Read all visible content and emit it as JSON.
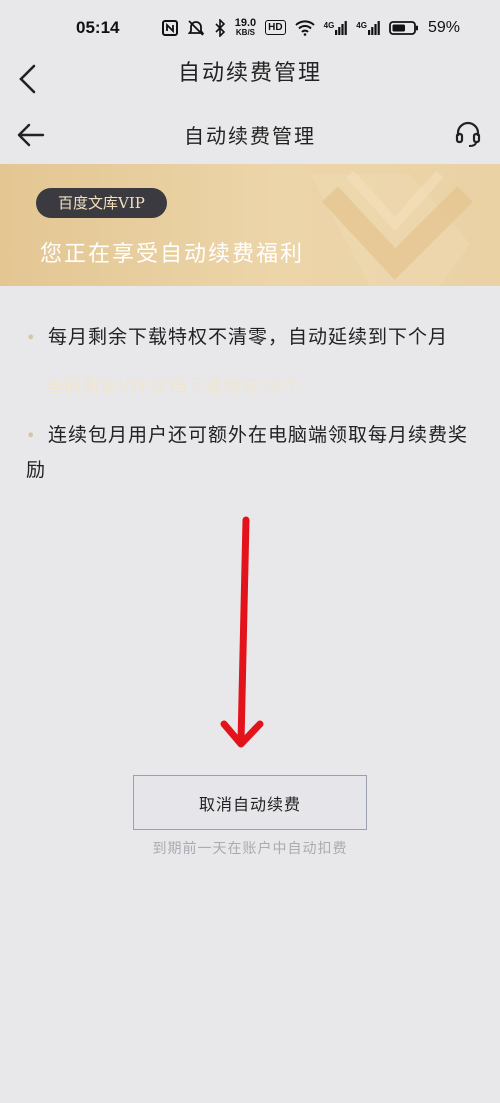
{
  "status_bar": {
    "time": "05:14",
    "speed_value": "19.0",
    "speed_unit": "KB/S",
    "hd": "HD",
    "net1": "4G",
    "net2": "4G",
    "battery": "59%"
  },
  "outer_header": {
    "title": "自动续费管理"
  },
  "inner_header": {
    "title": "自动续费管理"
  },
  "banner": {
    "badge": "百度文库VIP",
    "headline": "您正在享受自动续费福利"
  },
  "benefits": [
    {
      "bullet": "•",
      "text": "每月剩余下载特权不清零，自动延续到下个月"
    },
    {
      "bullet": "•",
      "text": "连续包月用户还可额外在电脑端领取每月续费奖励"
    }
  ],
  "remaining_note": "当前剩余VIP文档下载特权28个",
  "cancel_button": "取消自动续费",
  "renew_note": "到期前一天在账户中自动扣费",
  "colors": {
    "background": "#e8e8ea",
    "banner": "#e6cb9b",
    "badge_bg": "#3b3a40",
    "arrow": "#e3131b"
  }
}
